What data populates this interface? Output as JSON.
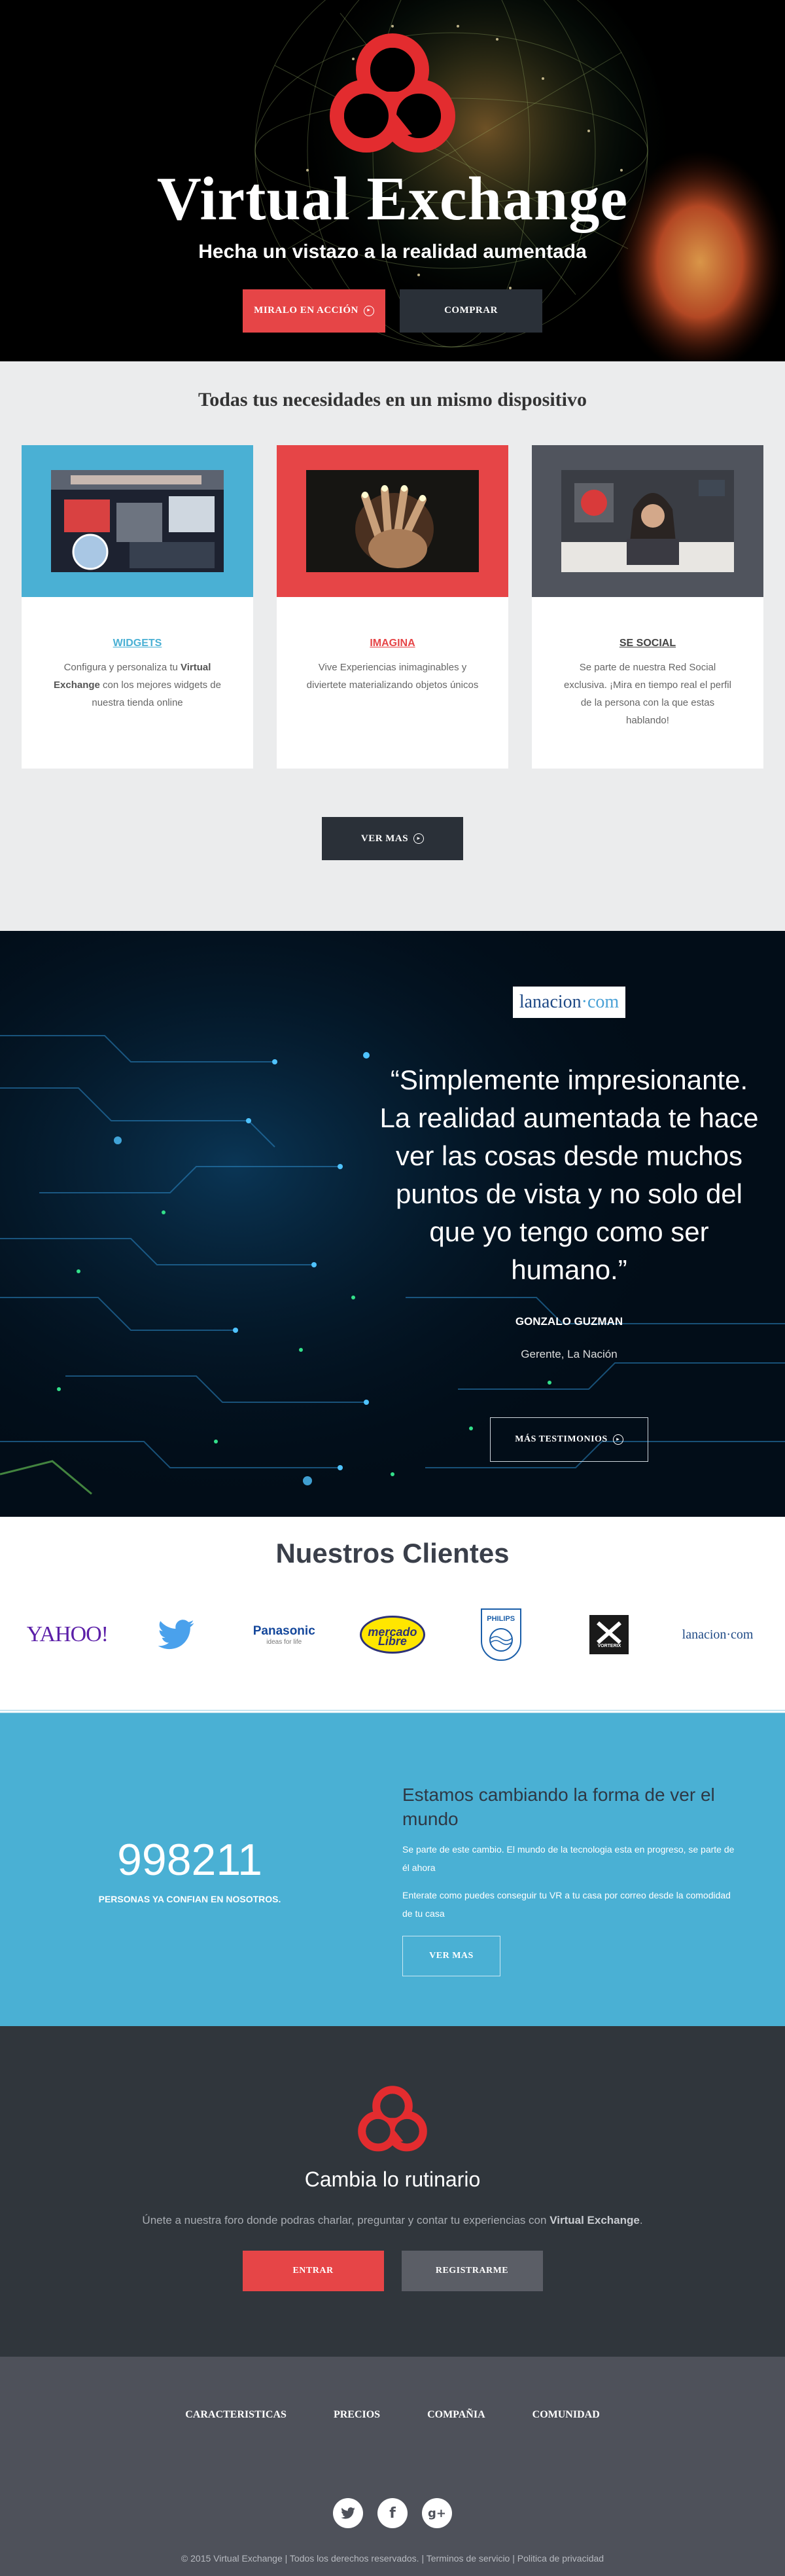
{
  "hero": {
    "title": "Virtual Exchange",
    "subtitle": "Hecha un vistazo a la realidad aumentada",
    "primary_button": "MIRALO EN ACCIÓN",
    "secondary_button": "COMPRAR"
  },
  "features": {
    "heading": "Todas tus necesidades en un mismo dispositivo",
    "cards": [
      {
        "title": "WIDGETS",
        "text_before": "Configura y personaliza tu ",
        "text_bold": "Virtual Exchange",
        "text_after": " con los mejores widgets de nuestra tienda online"
      },
      {
        "title": "IMAGINA",
        "text": "Vive Experiencias inimaginables y diviertete materializando objetos únicos"
      },
      {
        "title": "SE SOCIAL",
        "text": "Se parte de nuestra Red Social exclusiva. ¡Mira en tiempo real el perfil de la persona con la que estas hablando!"
      }
    ],
    "more_button": "VER MAS"
  },
  "testimonial": {
    "logo_main": "lanacion",
    "logo_suffix": "·com",
    "quote": "“Simplemente impresionante. La realidad aumentada te hace ver las cosas desde muchos puntos de vista y no solo del que yo tengo como ser humano.”",
    "name": "GONZALO GUZMAN",
    "role": "Gerente, La Nación",
    "button": "MÁS TESTIMONIOS"
  },
  "clients": {
    "heading": "Nuestros Clientes",
    "logos": {
      "yahoo": "YAHOO!",
      "panasonic": "Panasonic",
      "panasonic_tag": "ideas for life",
      "mercado_1": "mercado",
      "mercado_2": "Libre",
      "philips": "PHILIPS",
      "vorterix": "VORTERIX",
      "lanacion": "lanacion·com"
    }
  },
  "stats": {
    "number": "998211",
    "label": "PERSONAS YA CONFIAN EN NOSOTROS.",
    "heading": "Estamos cambiando la forma de ver el mundo",
    "p1": "Se parte de este cambio. El mundo de la tecnologia esta en progreso, se parte de él ahora",
    "p2": "Enterate como puedes conseguir tu VR a tu casa por correo desde la comodidad de tu casa",
    "button": "VER MAS"
  },
  "join": {
    "heading": "Cambia lo rutinario",
    "text_before": "Únete a nuestra foro donde podras charlar, preguntar y contar tu experiencias con ",
    "text_bold": "Virtual Exchange",
    "text_after": ".",
    "enter_button": "ENTRAR",
    "register_button": "REGISTRARME"
  },
  "footer": {
    "nav": [
      "CARACTERISTICAS",
      "PRECIOS",
      "COMPAÑIA",
      "COMUNIDAD"
    ],
    "socials": [
      "twitter-icon",
      "facebook-icon",
      "google-plus-icon"
    ],
    "copyright": "© 2015 Virtual Exchange | Todos los derechos reservados. | Terminos de servicio | Politica de privacidad"
  },
  "colors": {
    "red": "#e64547",
    "blue": "#4ab0d4",
    "dark": "#30363c",
    "footer": "#4e515a"
  }
}
